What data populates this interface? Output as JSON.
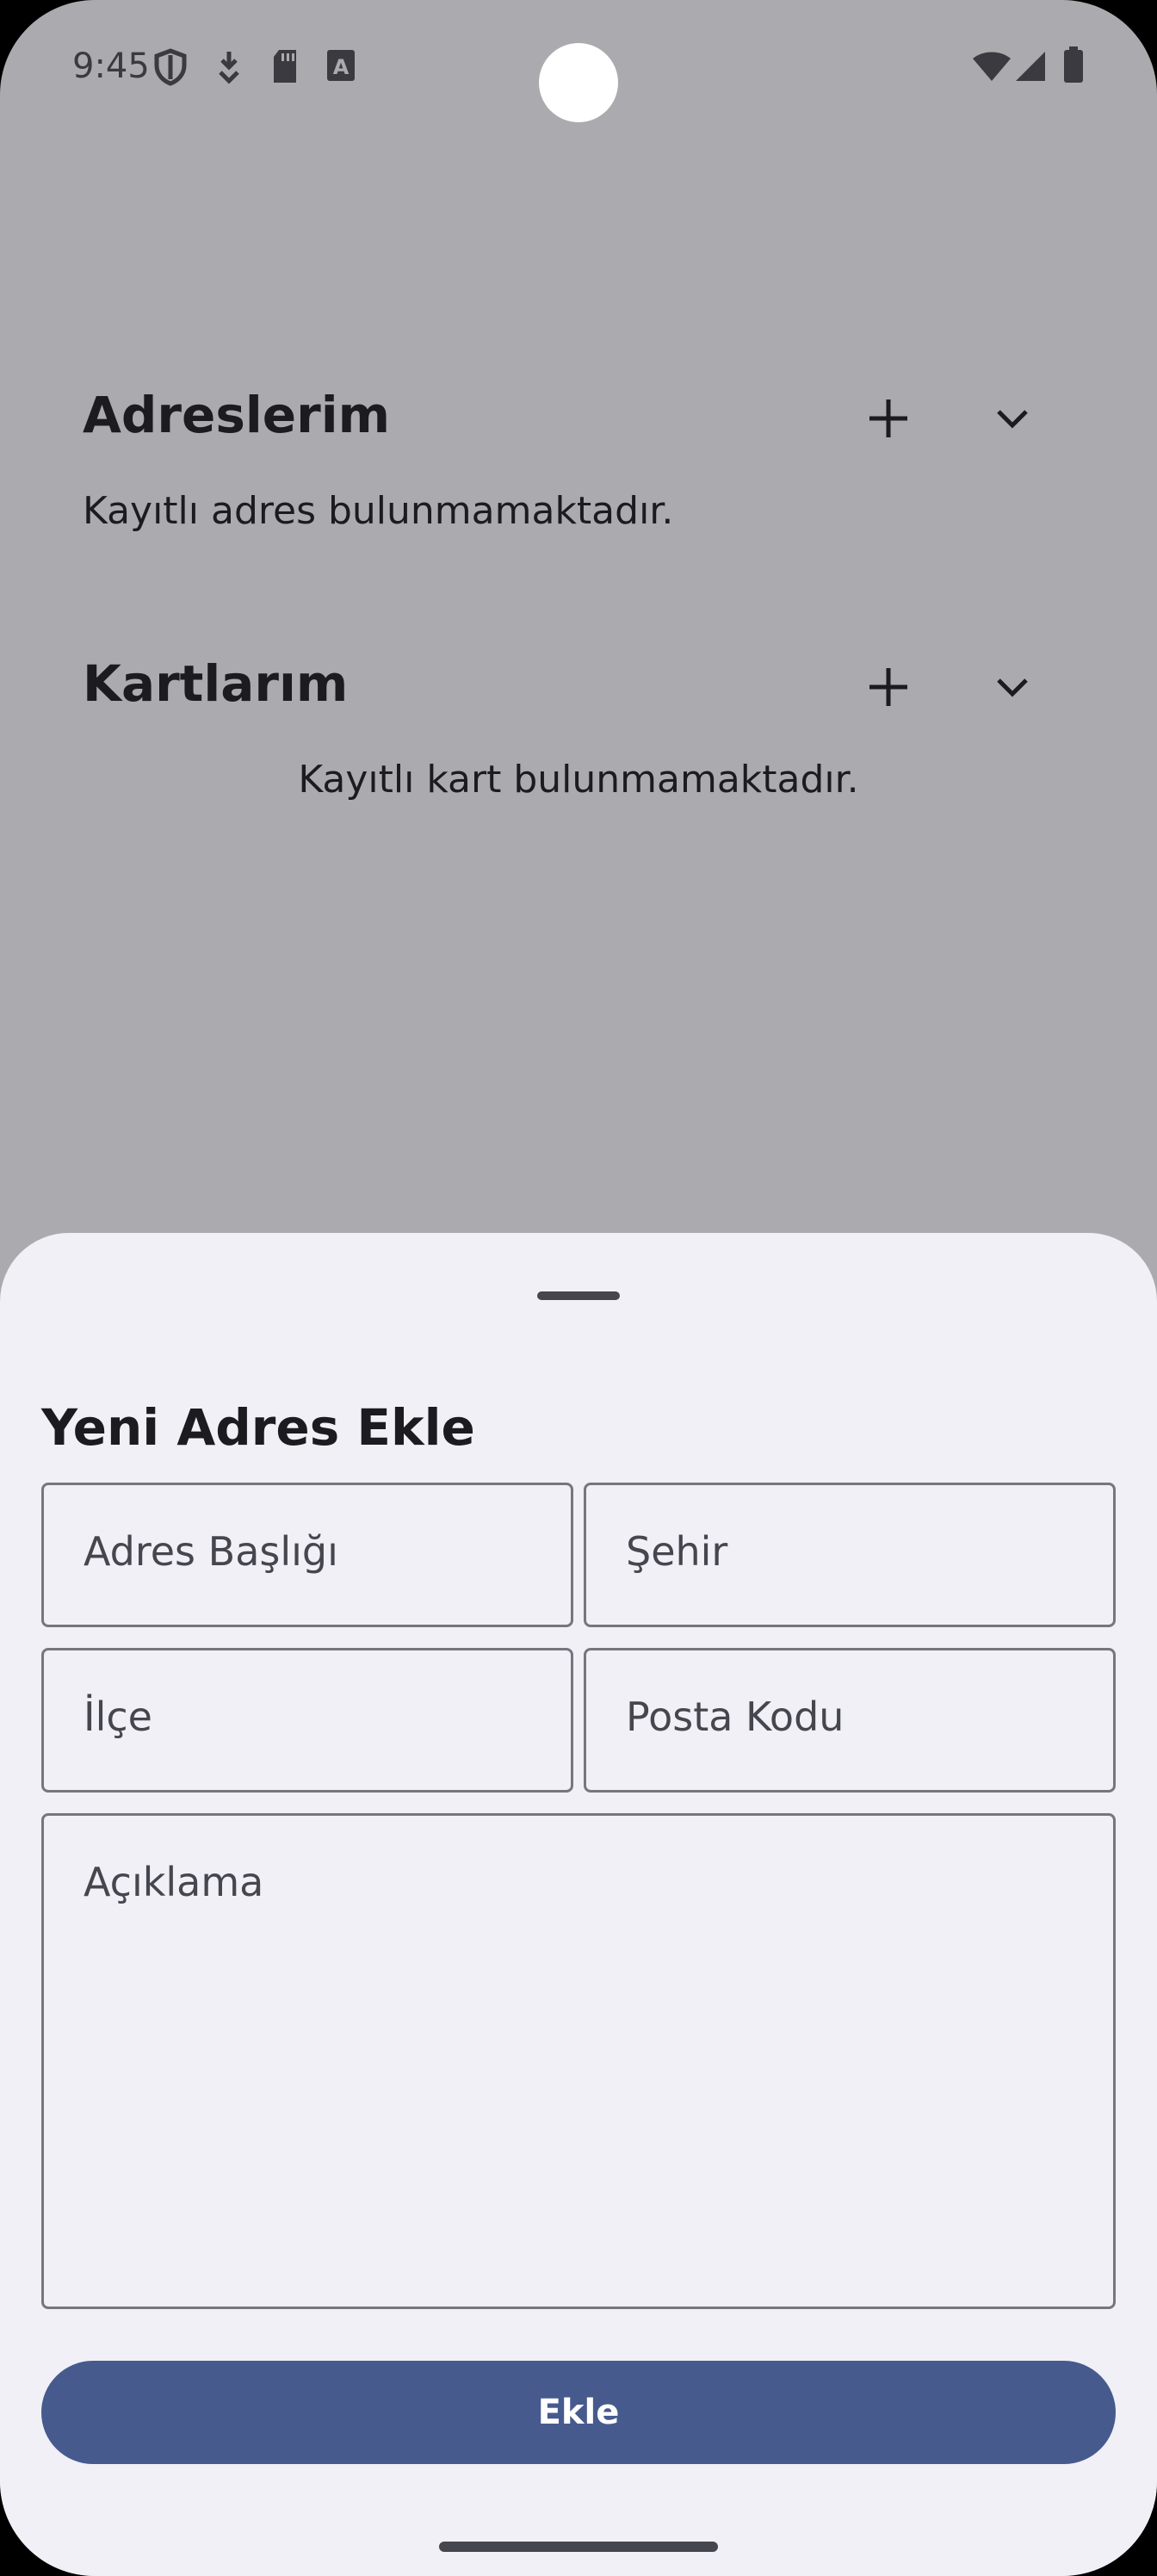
{
  "status_bar": {
    "time": "9:45",
    "left_icons": [
      "shield-icon",
      "download-icon",
      "sd-card-icon",
      "font-icon"
    ],
    "right_icons": [
      "wifi-icon",
      "signal-icon",
      "battery-icon"
    ]
  },
  "addresses_section": {
    "title": "Adreslerim",
    "empty_text": "Kayıtlı adres bulunmamaktadır."
  },
  "cards_section": {
    "title": "Kartlarım",
    "empty_text": "Kayıtlı kart bulunmamaktadır."
  },
  "sheet": {
    "title": "Yeni Adres Ekle",
    "fields": {
      "address_title": "Adres Başlığı",
      "city": "Şehir",
      "district": "İlçe",
      "postal_code": "Posta Kodu",
      "description": "Açıklama"
    },
    "submit_label": "Ekle"
  },
  "colors": {
    "scrim_background": "#abaaae",
    "sheet_background": "#f1f0f7",
    "primary": "#465a8e"
  }
}
